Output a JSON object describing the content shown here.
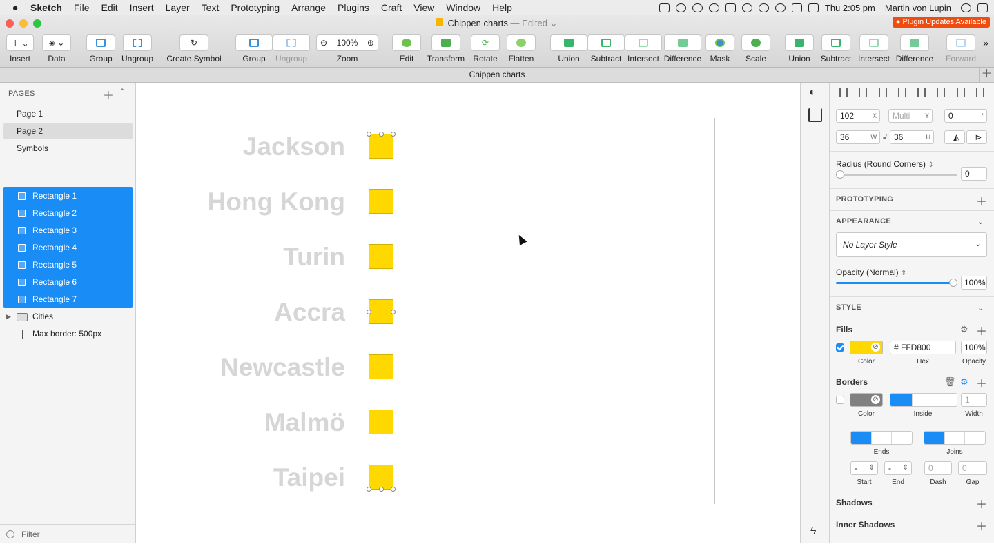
{
  "menubar": {
    "app_name": "Sketch",
    "items": [
      "File",
      "Edit",
      "Insert",
      "Layer",
      "Text",
      "Prototyping",
      "Arrange",
      "Plugins",
      "Craft",
      "View",
      "Window",
      "Help"
    ],
    "clock": "Thu 2:05 pm",
    "user": "Martin von Lupin"
  },
  "window": {
    "doc_title": "Chippen charts",
    "edited": "— Edited",
    "plugin_badge": "Plugin Updates Available",
    "tab_title": "Chippen charts"
  },
  "toolbar": {
    "insert": "Insert",
    "data": "Data",
    "group": "Group",
    "ungroup": "Ungroup",
    "create_symbol": "Create Symbol",
    "group2": "Group",
    "ungroup2": "Ungroup",
    "zoom_label": "Zoom",
    "zoom_value": "100%",
    "edit": "Edit",
    "transform": "Transform",
    "rotate": "Rotate",
    "flatten": "Flatten",
    "union": "Union",
    "subtract": "Subtract",
    "intersect": "Intersect",
    "difference": "Difference",
    "mask": "Mask",
    "scale": "Scale",
    "union2": "Union",
    "subtract2": "Subtract",
    "intersect2": "Intersect",
    "difference2": "Difference",
    "forward": "Forward"
  },
  "pages_panel": {
    "header": "PAGES",
    "pages": [
      "Page 1",
      "Page 2",
      "Symbols"
    ],
    "selected_page": "Page 2"
  },
  "layers": {
    "selected": [
      "Rectangle 1",
      "Rectangle 2",
      "Rectangle 3",
      "Rectangle 4",
      "Rectangle 5",
      "Rectangle 6",
      "Rectangle 7"
    ],
    "group": "Cities",
    "line": "Max border: 500px"
  },
  "filter": "Filter",
  "canvas": {
    "cities": [
      "Jackson",
      "Hong Kong",
      "Turin",
      "Accra",
      "Newcastle",
      "Malmö",
      "Taipei"
    ],
    "fill_color": "#FFD800",
    "label_color": "#D6D6D6"
  },
  "inspector": {
    "x": "102",
    "x_suffix": "X",
    "y": "Multi",
    "y_suffix": "Y",
    "rotation": "0",
    "rotation_suffix": "°",
    "w": "36",
    "w_suffix": "W",
    "h": "36",
    "h_suffix": "H",
    "radius_label": "Radius (Round Corners)",
    "radius_value": "0",
    "prototyping": "PROTOTYPING",
    "appearance": "APPEARANCE",
    "layer_style": "No Layer Style",
    "opacity_label": "Opacity (Normal)",
    "opacity_value": "100%",
    "opacity_fraction": 1.0,
    "style": "STYLE",
    "fills_label": "Fills",
    "fill_hex": "FFD800",
    "fill_opacity": "100%",
    "fill_swatch": "#FFD800",
    "color_lbl": "Color",
    "hex_lbl": "Hex",
    "opacity_lbl": "Opacity",
    "borders_label": "Borders",
    "border_swatch": "#808080",
    "border_width": "1",
    "inside_lbl": "Inside",
    "width_lbl": "Width",
    "ends_lbl": "Ends",
    "joins_lbl": "Joins",
    "start_val": "-",
    "end_val": "-",
    "dash_val": "0",
    "gap_val": "0",
    "start_lbl": "Start",
    "end_lbl": "End",
    "dash_lbl": "Dash",
    "gap_lbl": "Gap",
    "shadows": "Shadows",
    "inner_shadows": "Inner Shadows"
  }
}
